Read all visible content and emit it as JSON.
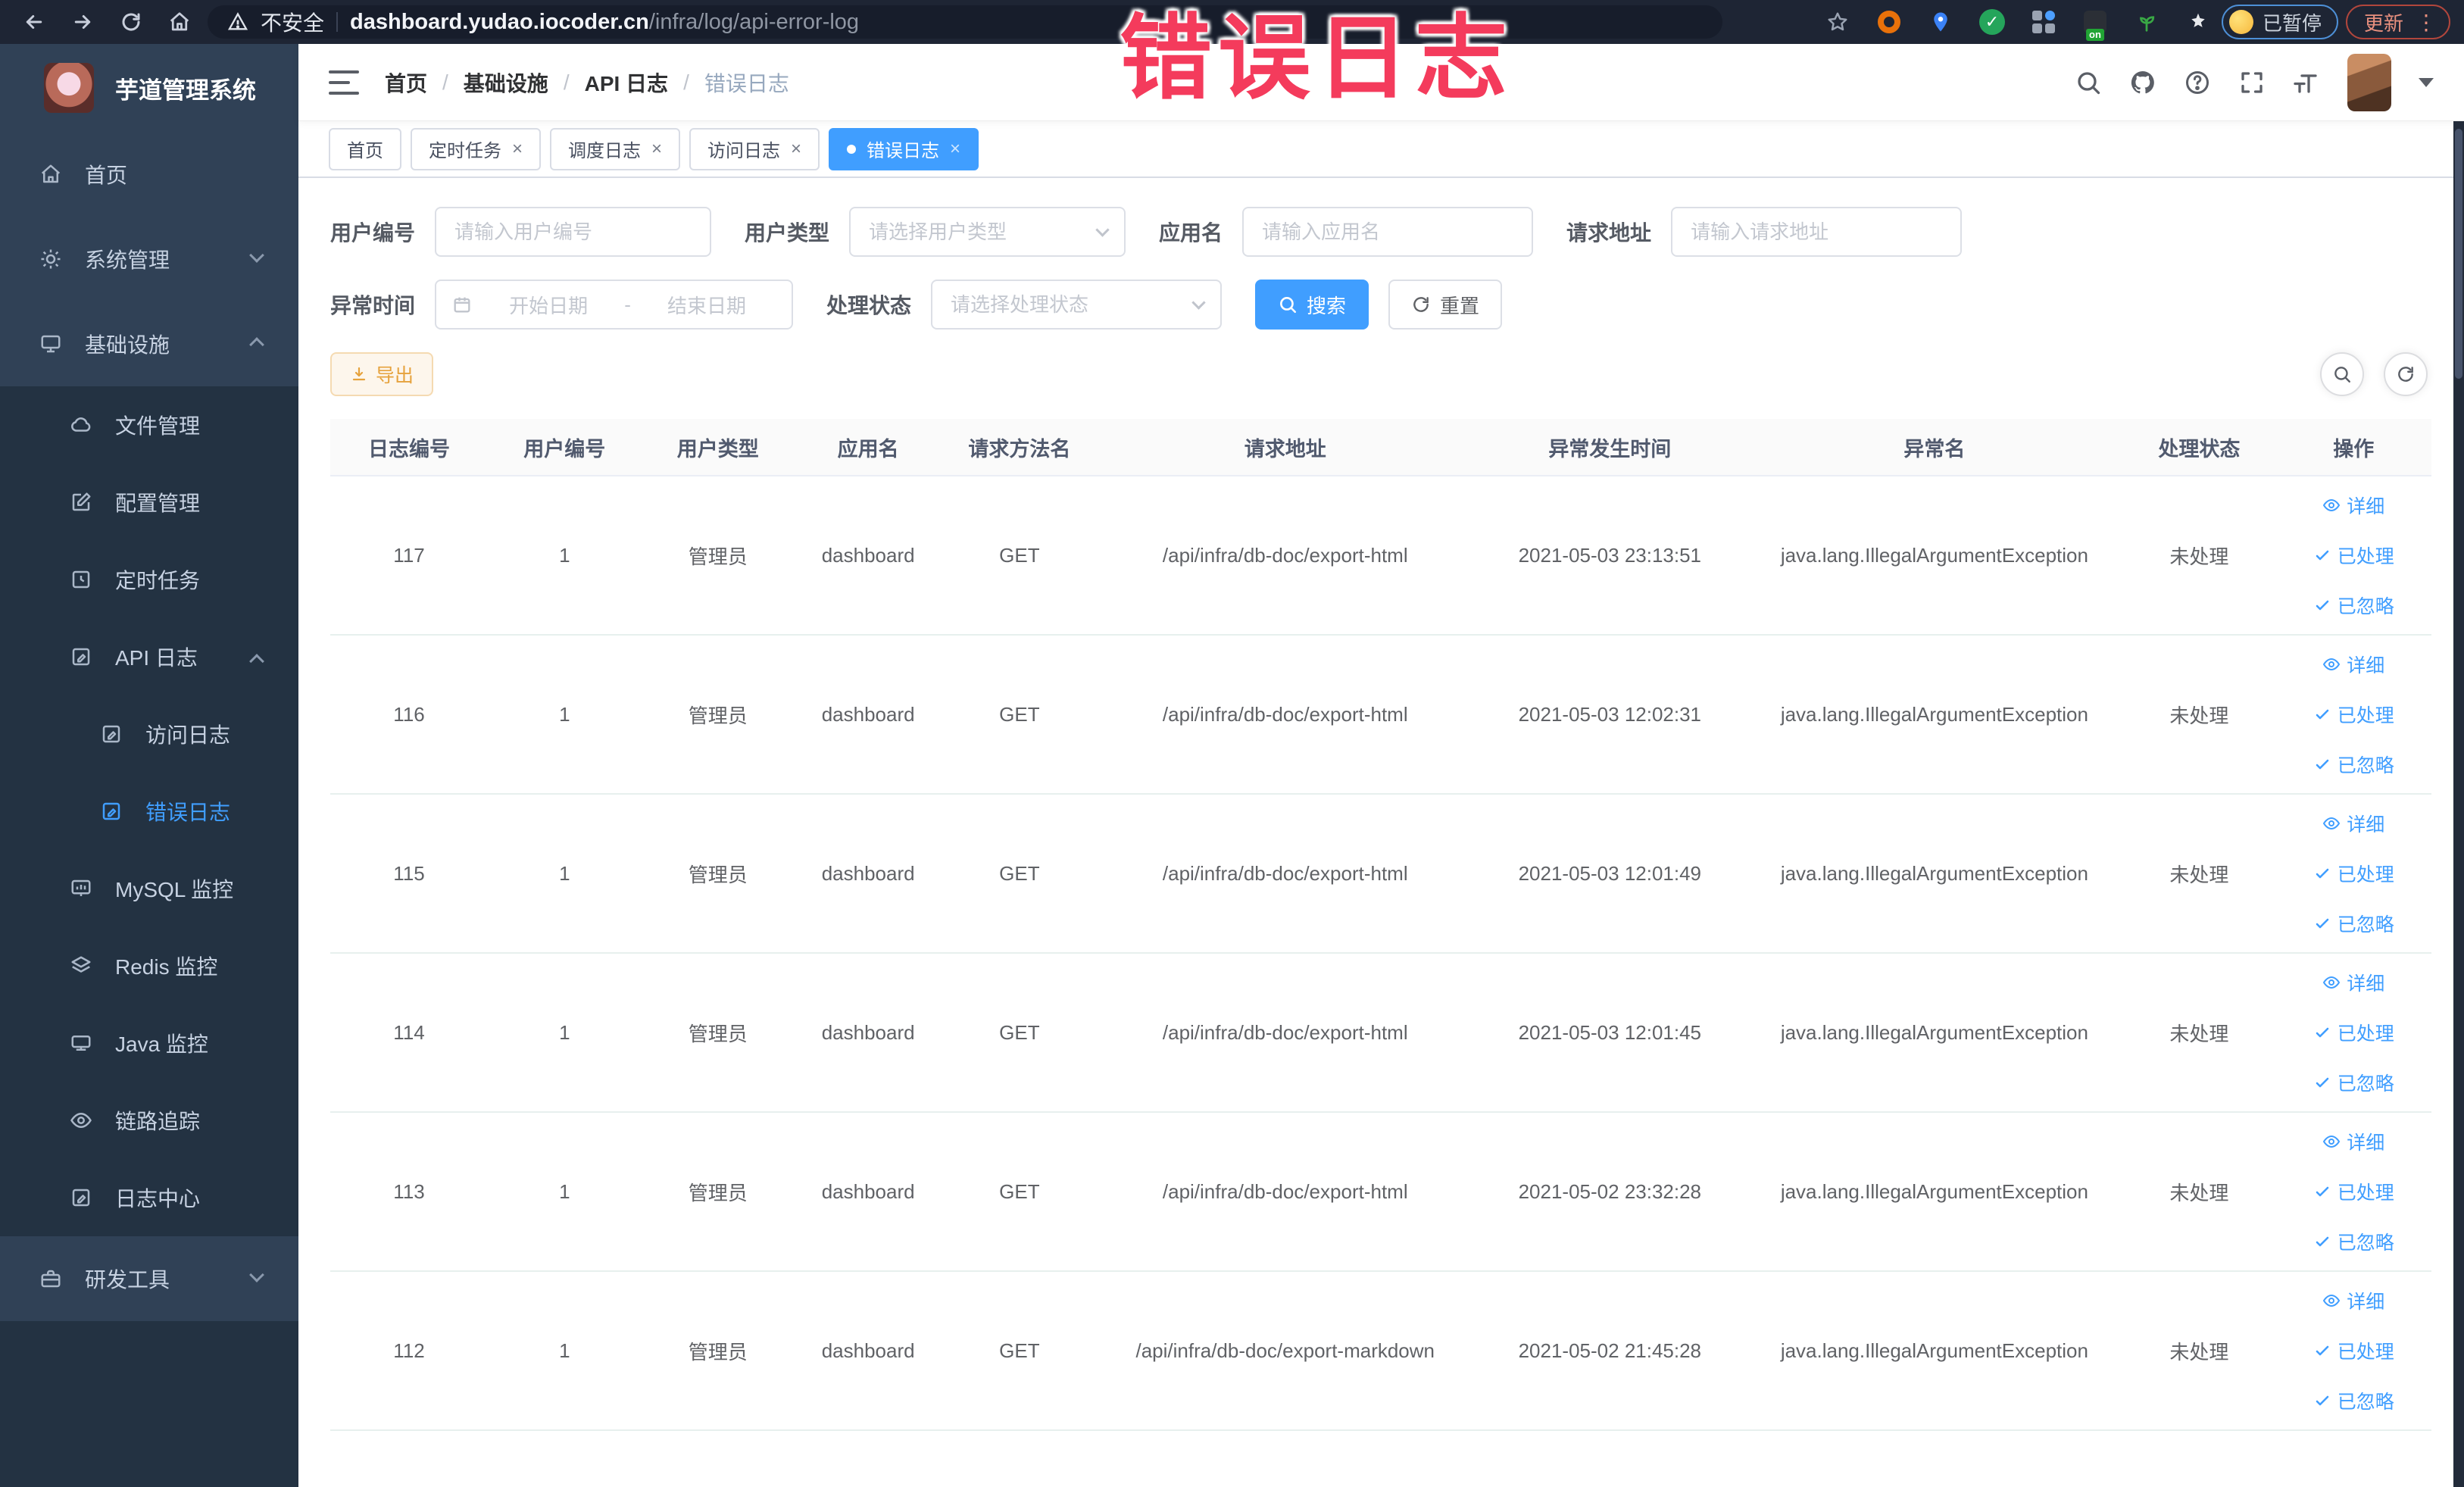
{
  "browser": {
    "nav_icons": [
      "back-icon",
      "forward-icon",
      "reload-icon",
      "home-icon"
    ],
    "security_label": "不安全",
    "url_domain": "dashboard.yudao.iocoder.cn",
    "url_path": "/infra/log/api-error-log",
    "extensions": [
      {
        "name": "bookmark-star-icon"
      },
      {
        "name": "adblock-extension-icon"
      },
      {
        "name": "location-extension-icon"
      },
      {
        "name": "green-check-extension-icon"
      },
      {
        "name": "grid-extension-icon"
      },
      {
        "name": "proxy-extension-icon",
        "badge": "on"
      },
      {
        "name": "sprout-extension-icon"
      },
      {
        "name": "puzzle-extension-icon"
      }
    ],
    "profile_chip_label": "已暂停",
    "update_button_label": "更新"
  },
  "overlay": {
    "annotation": "错误日志"
  },
  "sidebar": {
    "title": "芋道管理系统",
    "items": [
      {
        "label": "首页",
        "level": 1,
        "icon": "home2",
        "chevron": "",
        "active": false
      },
      {
        "label": "系统管理",
        "level": 1,
        "icon": "gear",
        "chevron": "down",
        "active": false
      },
      {
        "label": "基础设施",
        "level": 1,
        "icon": "monitor",
        "chevron": "up",
        "active": false
      },
      {
        "label": "文件管理",
        "level": 2,
        "icon": "cloud",
        "chevron": "",
        "active": false
      },
      {
        "label": "配置管理",
        "level": 2,
        "icon": "edit",
        "chevron": "",
        "active": false
      },
      {
        "label": "定时任务",
        "level": 2,
        "icon": "timer",
        "chevron": "",
        "active": false
      },
      {
        "label": "API 日志",
        "level": 2,
        "icon": "logdoc",
        "chevron": "up",
        "active": false
      },
      {
        "label": "访问日志",
        "level": 3,
        "icon": "logdoc",
        "chevron": "",
        "active": false
      },
      {
        "label": "错误日志",
        "level": 3,
        "icon": "logdoc",
        "chevron": "",
        "active": true
      },
      {
        "label": "MySQL 监控",
        "level": 2,
        "icon": "chart",
        "chevron": "",
        "active": false
      },
      {
        "label": "Redis 监控",
        "level": 2,
        "icon": "layers",
        "chevron": "",
        "active": false
      },
      {
        "label": "Java 监控",
        "level": 2,
        "icon": "javamon",
        "chevron": "",
        "active": false
      },
      {
        "label": "链路追踪",
        "level": 2,
        "icon": "eye",
        "chevron": "",
        "active": false
      },
      {
        "label": "日志中心",
        "level": 2,
        "icon": "logdoc",
        "chevron": "",
        "active": false
      },
      {
        "label": "研发工具",
        "level": 1,
        "icon": "tools",
        "chevron": "down",
        "active": false
      }
    ]
  },
  "header": {
    "breadcrumbs": [
      "首页",
      "基础设施",
      "API 日志",
      "错误日志"
    ],
    "action_icons": [
      "search-icon",
      "github-icon",
      "help-icon",
      "fullscreen-icon",
      "font-size-icon"
    ]
  },
  "tabs": [
    {
      "label": "首页",
      "closable": false,
      "active": false
    },
    {
      "label": "定时任务",
      "closable": true,
      "active": false
    },
    {
      "label": "调度日志",
      "closable": true,
      "active": false
    },
    {
      "label": "访问日志",
      "closable": true,
      "active": false
    },
    {
      "label": "错误日志",
      "closable": true,
      "active": true
    }
  ],
  "filters": {
    "user_id_label": "用户编号",
    "user_id_placeholder": "请输入用户编号",
    "user_type_label": "用户类型",
    "user_type_placeholder": "请选择用户类型",
    "app_name_label": "应用名",
    "app_name_placeholder": "请输入应用名",
    "request_url_label": "请求地址",
    "request_url_placeholder": "请输入请求地址",
    "exception_time_label": "异常时间",
    "date_start_placeholder": "开始日期",
    "date_separator": "-",
    "date_end_placeholder": "结束日期",
    "process_status_label": "处理状态",
    "process_status_placeholder": "请选择处理状态",
    "search_button": "搜索",
    "reset_button": "重置"
  },
  "toolbar": {
    "export_label": "导出"
  },
  "table": {
    "columns": [
      "日志编号",
      "用户编号",
      "用户类型",
      "应用名",
      "请求方法名",
      "请求地址",
      "异常发生时间",
      "异常名",
      "处理状态",
      "操作"
    ],
    "row_actions": [
      {
        "label": "详细",
        "icon": "eyes"
      },
      {
        "label": "已处理",
        "icon": "check"
      },
      {
        "label": "已忽略",
        "icon": "check"
      }
    ],
    "rows": [
      {
        "id": "117",
        "user_id": "1",
        "user_type": "管理员",
        "app_name": "dashboard",
        "method": "GET",
        "url": "/api/infra/db-doc/export-html",
        "time": "2021-05-03 23:13:51",
        "exception": "java.lang.IllegalArgumentException",
        "status": "未处理"
      },
      {
        "id": "116",
        "user_id": "1",
        "user_type": "管理员",
        "app_name": "dashboard",
        "method": "GET",
        "url": "/api/infra/db-doc/export-html",
        "time": "2021-05-03 12:02:31",
        "exception": "java.lang.IllegalArgumentException",
        "status": "未处理"
      },
      {
        "id": "115",
        "user_id": "1",
        "user_type": "管理员",
        "app_name": "dashboard",
        "method": "GET",
        "url": "/api/infra/db-doc/export-html",
        "time": "2021-05-03 12:01:49",
        "exception": "java.lang.IllegalArgumentException",
        "status": "未处理"
      },
      {
        "id": "114",
        "user_id": "1",
        "user_type": "管理员",
        "app_name": "dashboard",
        "method": "GET",
        "url": "/api/infra/db-doc/export-html",
        "time": "2021-05-03 12:01:45",
        "exception": "java.lang.IllegalArgumentException",
        "status": "未处理"
      },
      {
        "id": "113",
        "user_id": "1",
        "user_type": "管理员",
        "app_name": "dashboard",
        "method": "GET",
        "url": "/api/infra/db-doc/export-html",
        "time": "2021-05-02 23:32:28",
        "exception": "java.lang.IllegalArgumentException",
        "status": "未处理"
      },
      {
        "id": "112",
        "user_id": "1",
        "user_type": "管理员",
        "app_name": "dashboard",
        "method": "GET",
        "url": "/api/infra/db-doc/export-markdown",
        "time": "2021-05-02 21:45:28",
        "exception": "java.lang.IllegalArgumentException",
        "status": "未处理"
      }
    ]
  }
}
